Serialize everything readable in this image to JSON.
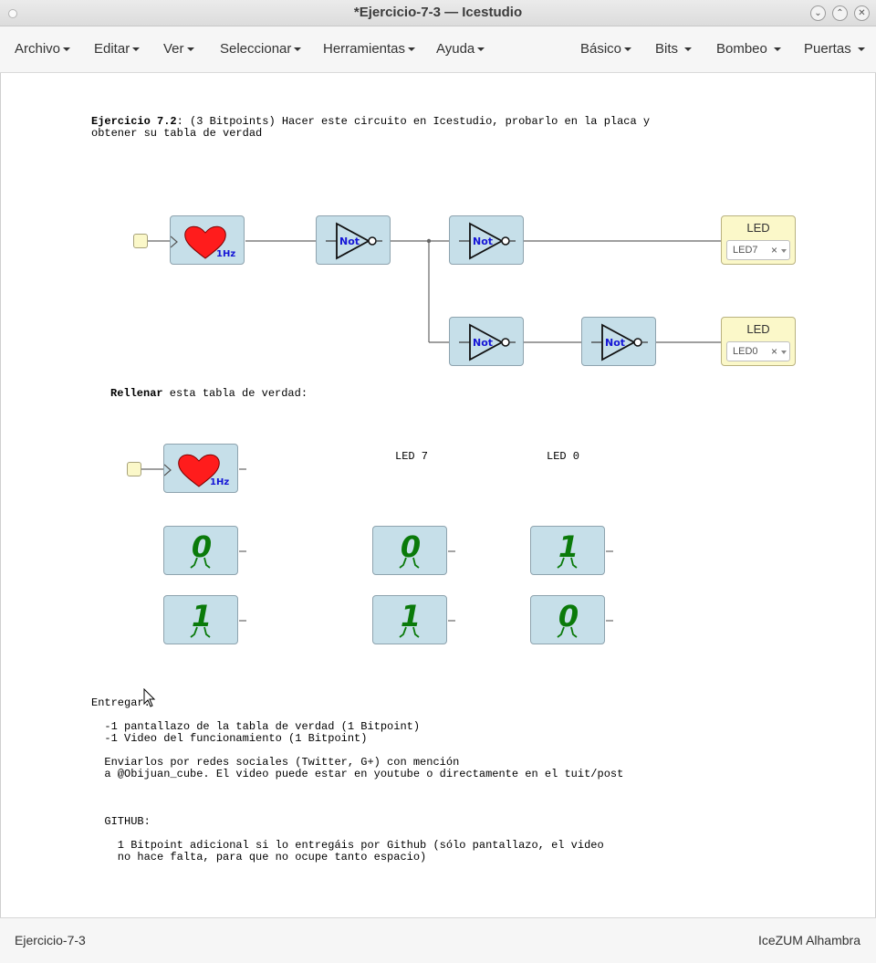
{
  "window": {
    "title": "*Ejercicio-7-3 — Icestudio"
  },
  "menubar": {
    "left": [
      "Archivo",
      "Editar",
      "Ver",
      "Seleccionar",
      "Herramientas",
      "Ayuda"
    ],
    "right": [
      "Básico",
      "Bits",
      "Bombeo",
      "Puertas"
    ]
  },
  "notes": {
    "intro_bold": "Ejercicio 7.2",
    "intro_rest": ": (3 Bitpoints) Hacer este circuito en Icestudio, probarlo en la placa y",
    "intro_line2": "obtener su tabla de verdad",
    "fill_bold": "Rellenar",
    "fill_rest": " esta tabla de verdad:",
    "col_led7": "LED 7",
    "col_led0": "LED 0",
    "deliver": "Entregar:\n\n  -1 pantallazo de la tabla de verdad (1 Bitpoint)\n  -1 Video del funcionamiento (1 Bitpoint)\n\n  Enviarlos por redes sociales (Twitter, G+) con mención\n  a @Obijuan_cube. El video puede estar en youtube o directamente en el tuit/post\n\n\n\n  GITHUB:\n\n    1 Bitpoint adicional si lo entregáis por Github (sólo pantallazo, el video\n    no hace falta, para que no ocupe tanto espacio)"
  },
  "blocks": {
    "heart_label": "1Hz",
    "not_label": "Not",
    "led_title": "LED",
    "led7_value": "LED7",
    "led0_value": "LED0",
    "clear_symbol": "×"
  },
  "truth_table": {
    "input": [
      "0",
      "1"
    ],
    "led7": [
      "0",
      "1"
    ],
    "led0": [
      "1",
      "0"
    ]
  },
  "statusbar": {
    "project": "Ejercicio-7-3",
    "board": "IceZUM Alhambra"
  },
  "colors": {
    "block": "#c6dfe9",
    "led": "#fbf8c9",
    "bit": "#0a7a0a",
    "not_text": "#1515d6",
    "heart": "#ff1c1c"
  }
}
